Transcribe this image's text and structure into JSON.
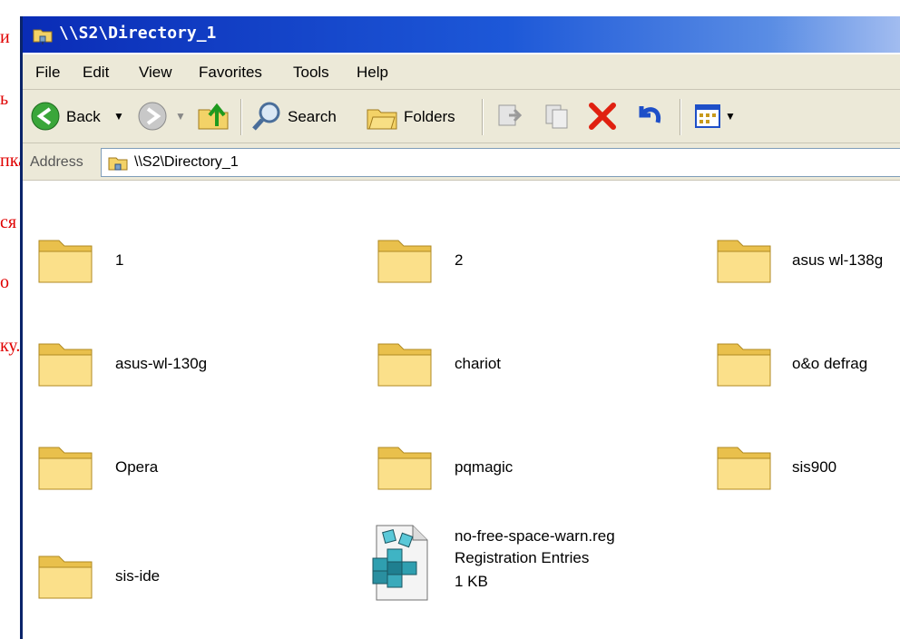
{
  "overlay_fragments": [
    "и",
    "ь",
    "пка",
    "ся в",
    "о",
    "ку."
  ],
  "window": {
    "title": "\\\\S2\\Directory_1"
  },
  "menu": [
    "File",
    "Edit",
    "View",
    "Favorites",
    "Tools",
    "Help"
  ],
  "toolbar": {
    "back_label": "Back",
    "search_label": "Search",
    "folders_label": "Folders"
  },
  "address": {
    "label": "Address",
    "value": "\\\\S2\\Directory_1"
  },
  "items": [
    {
      "name": "1",
      "type": "folder"
    },
    {
      "name": "2",
      "type": "folder"
    },
    {
      "name": "asus wl-138g",
      "type": "folder"
    },
    {
      "name": "asus-wl-130g",
      "type": "folder"
    },
    {
      "name": "chariot",
      "type": "folder"
    },
    {
      "name": "o&o defrag",
      "type": "folder"
    },
    {
      "name": "Opera",
      "type": "folder"
    },
    {
      "name": "pqmagic",
      "type": "folder"
    },
    {
      "name": "sis900",
      "type": "folder"
    },
    {
      "name": "sis-ide",
      "type": "folder"
    },
    {
      "name": "no-free-space-warn.reg",
      "type": "file",
      "file_type": "Registration Entries",
      "size": "1 KB"
    }
  ],
  "colors": {
    "overlay_text": "#e00000",
    "titlebar": "#0a2cb6",
    "chrome": "#ece9d8"
  }
}
